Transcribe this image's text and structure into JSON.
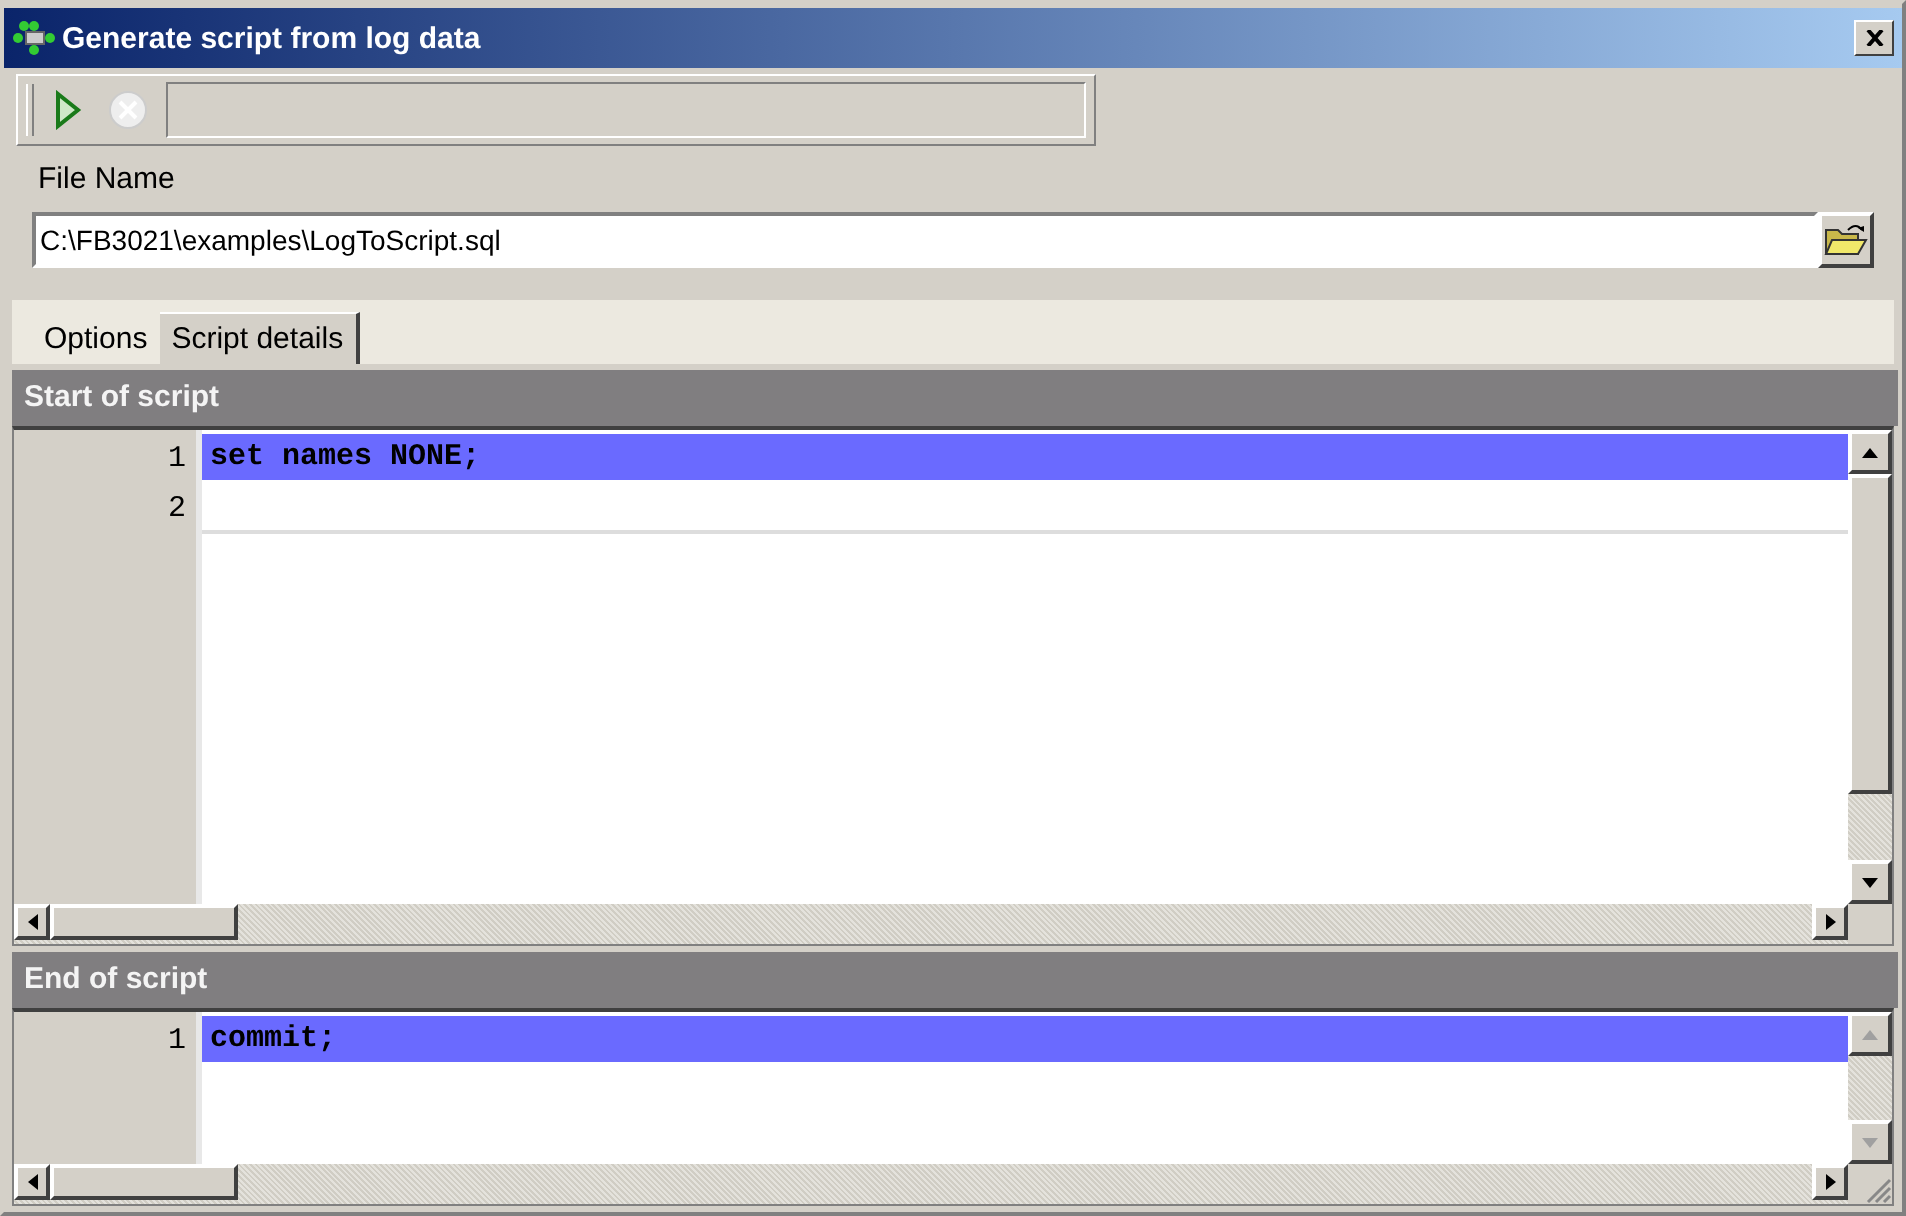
{
  "window": {
    "title": "Generate script from log data"
  },
  "toolbar": {
    "buttons": [
      {
        "kind": "run",
        "disabled": false
      },
      {
        "kind": "stop",
        "disabled": true
      }
    ]
  },
  "file_name": {
    "label": "File Name",
    "value": "C:\\FB3021\\examples\\LogToScript.sql"
  },
  "tabs": [
    {
      "label": "Options",
      "selected": false
    },
    {
      "label": "Script details",
      "selected": true
    }
  ],
  "panels": [
    {
      "title": "Start of script",
      "lines": [
        {
          "number": "1",
          "text": "set names NONE;",
          "selected": true
        },
        {
          "number": "2",
          "selected": false
        }
      ]
    },
    {
      "title": "End of script",
      "lines": [
        {
          "number": "1",
          "text": "commit;",
          "selected": true
        }
      ]
    }
  ]
}
